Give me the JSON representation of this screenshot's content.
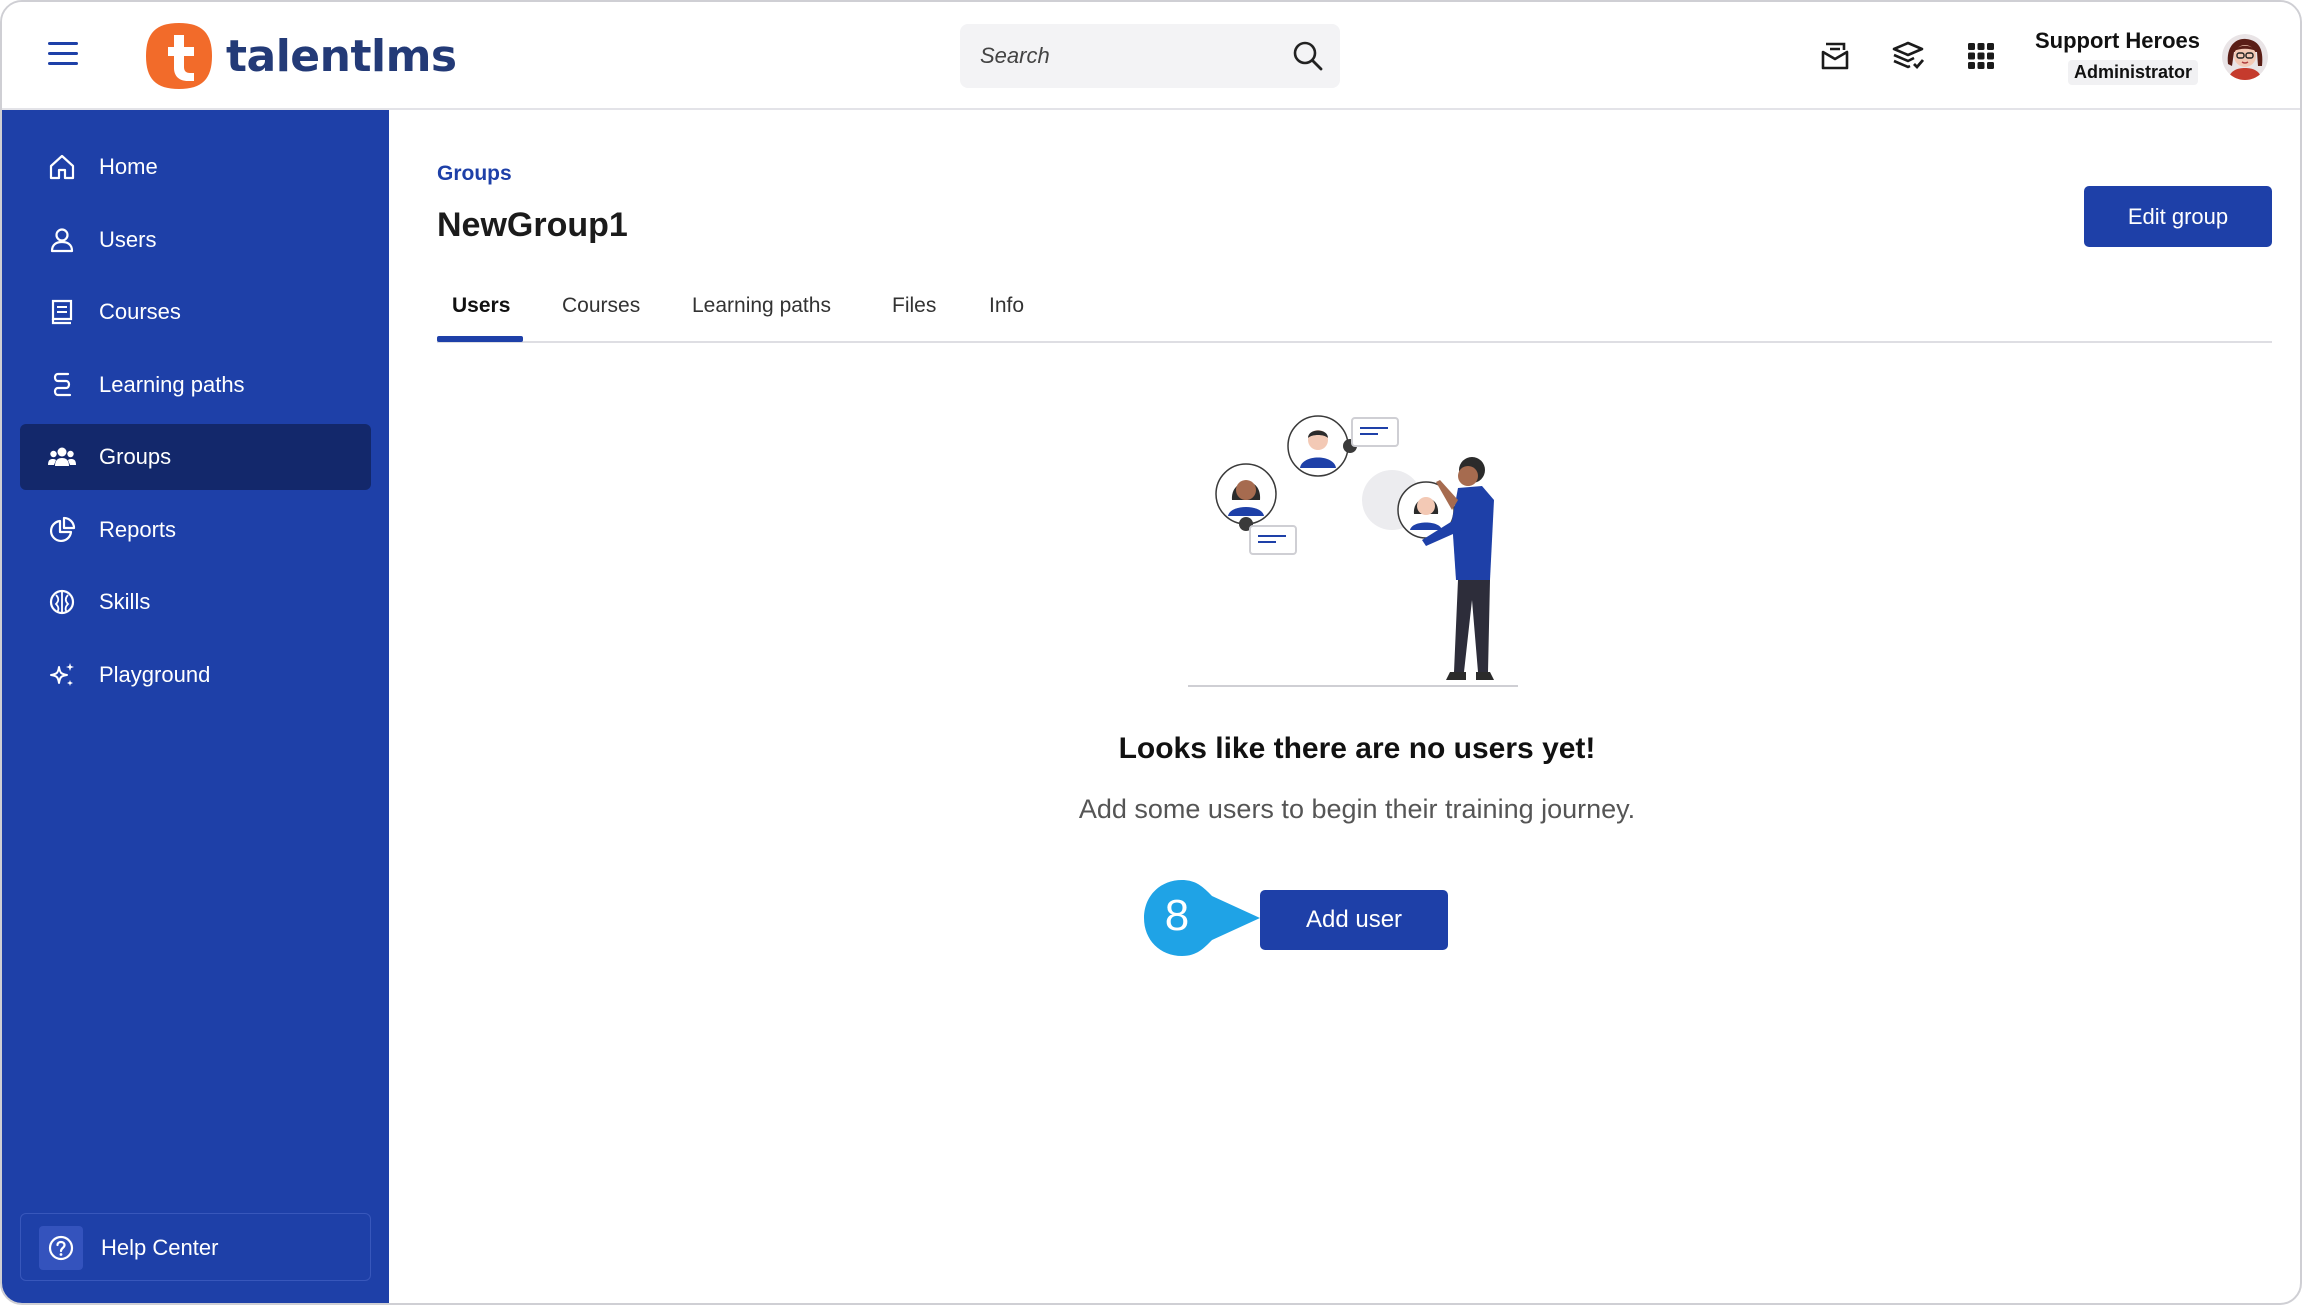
{
  "header": {
    "logo_text": "talentlms",
    "search_placeholder": "Search",
    "user_name": "Support Heroes",
    "user_role": "Administrator",
    "icons": [
      "hamburger-icon",
      "inbox-icon",
      "courses-stack-icon",
      "apps-grid-icon"
    ]
  },
  "sidebar": {
    "items": [
      {
        "label": "Home",
        "icon": "home-icon"
      },
      {
        "label": "Users",
        "icon": "user-icon"
      },
      {
        "label": "Courses",
        "icon": "book-icon"
      },
      {
        "label": "Learning paths",
        "icon": "path-icon"
      },
      {
        "label": "Groups",
        "icon": "groups-icon",
        "active": true
      },
      {
        "label": "Reports",
        "icon": "pie-chart-icon"
      },
      {
        "label": "Skills",
        "icon": "brain-icon"
      },
      {
        "label": "Playground",
        "icon": "sparkles-icon"
      }
    ],
    "help_label": "Help Center"
  },
  "main": {
    "breadcrumb": "Groups",
    "title": "NewGroup1",
    "edit_button": "Edit group",
    "tabs": [
      {
        "label": "Users",
        "active": true
      },
      {
        "label": "Courses"
      },
      {
        "label": "Learning paths"
      },
      {
        "label": "Files"
      },
      {
        "label": "Info"
      }
    ],
    "empty_title": "Looks like there are no users yet!",
    "empty_subtitle": "Add some users to begin their training journey.",
    "add_button": "Add user",
    "step_number": "8"
  },
  "colors": {
    "brand_blue": "#1e40a8",
    "sidebar_active": "#13286b",
    "logo_orange": "#f26b2a",
    "callout_cyan": "#1fa3e6"
  }
}
